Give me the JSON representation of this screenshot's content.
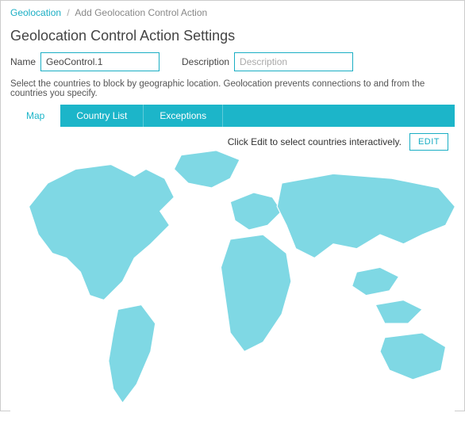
{
  "breadcrumb": {
    "root": "Geolocation",
    "current": "Add Geolocation Control Action"
  },
  "title": "Geolocation Control Action Settings",
  "fields": {
    "name_label": "Name",
    "name_value": "GeoControl.1",
    "desc_label": "Description",
    "desc_placeholder": "Description"
  },
  "helper_text": "Select the countries to block by geographic location. Geolocation prevents connections to and from the countries you specify.",
  "tabs": {
    "map": "Map",
    "country_list": "Country List",
    "exceptions": "Exceptions"
  },
  "map_hint": "Click Edit to select countries interactively.",
  "edit_label": "EDIT",
  "colors": {
    "accent": "#1cb5c9",
    "map_fill": "#7fd8e4"
  }
}
